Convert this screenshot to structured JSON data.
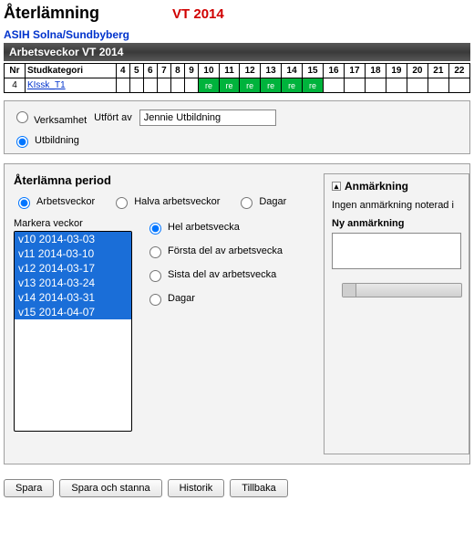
{
  "header": {
    "title": "Återlämning",
    "term": "VT 2014",
    "unit": "ASIH Solna/Sundbyberg",
    "section_bar": "Arbetsveckor VT 2014"
  },
  "weeks_table": {
    "cols": [
      "Nr",
      "Studkategori",
      "4",
      "5",
      "6",
      "7",
      "8",
      "9",
      "10",
      "11",
      "12",
      "13",
      "14",
      "15",
      "16",
      "17",
      "18",
      "19",
      "20",
      "21",
      "22"
    ],
    "row": {
      "nr": "4",
      "kategori": "KIssk_T1",
      "cells": [
        "",
        "",
        "",
        "",
        "",
        "",
        "re",
        "re",
        "re",
        "re",
        "re",
        "re",
        "",
        "",
        "",
        "",
        "",
        "",
        ""
      ]
    }
  },
  "mode": {
    "verksamhet_label": "Verksamhet",
    "utfort_av_label": "Utfört av",
    "utfort_av_value": "Jennie Utbildning",
    "utbildning_label": "Utbildning"
  },
  "period": {
    "title": "Återlämna period",
    "opt_arbetsveckor": "Arbetsveckor",
    "opt_halva": "Halva arbetsveckor",
    "opt_dagar": "Dagar",
    "markera_label": "Markera veckor",
    "weeks": [
      "v10 2014-03-03",
      "v11 2014-03-10",
      "v12 2014-03-17",
      "v13 2014-03-24",
      "v14 2014-03-31",
      "v15 2014-04-07"
    ],
    "detail_hel": "Hel arbetsvecka",
    "detail_forsta": "Första del av arbetsvecka",
    "detail_sista": "Sista del av arbetsvecka",
    "detail_dagar": "Dagar"
  },
  "anmark": {
    "title": "Anmärkning",
    "none_text": "Ingen anmärkning noterad i",
    "new_label": "Ny anmärkning",
    "toggle_glyph": "▴"
  },
  "buttons": {
    "spara": "Spara",
    "spara_stanna": "Spara och stanna",
    "historik": "Historik",
    "tillbaka": "Tillbaka"
  }
}
